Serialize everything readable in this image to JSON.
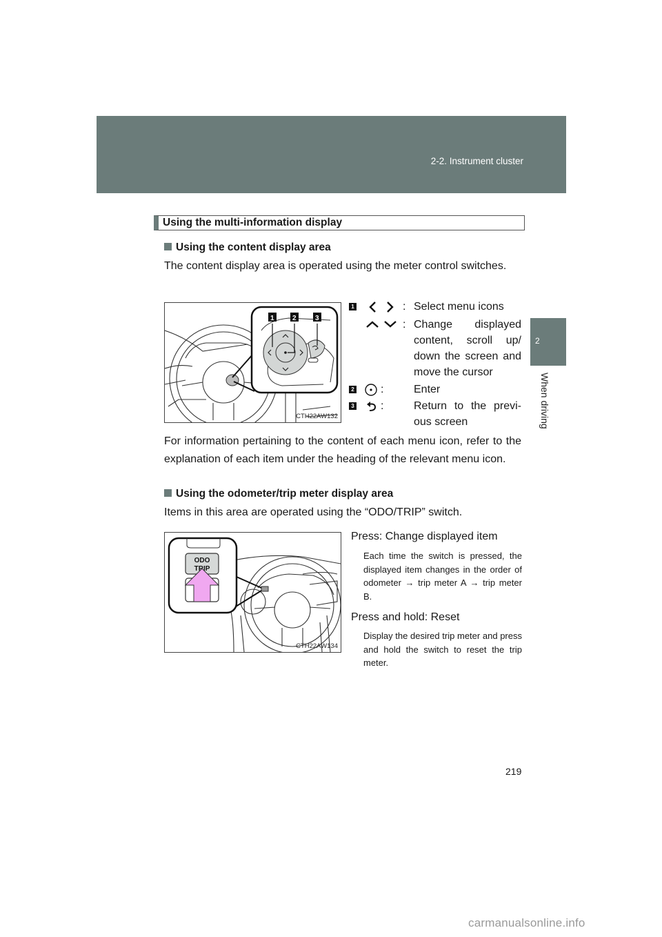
{
  "header": {
    "section": "2-2. Instrument cluster"
  },
  "chapter_tab": {
    "number": "2",
    "label": "When driving"
  },
  "section_title": "Using the multi-information display",
  "content_area": {
    "heading": "Using the content display area",
    "intro": "The content display area is operated using the meter control switches.",
    "figure_code": "CTH22AW132",
    "callouts": [
      "1",
      "2",
      "3"
    ],
    "legend": [
      {
        "badge": "1",
        "icons": [
          "chevron-left-icon",
          "chevron-right-icon"
        ],
        "text": "Select menu icons"
      },
      {
        "badge": "",
        "icons": [
          "chevron-up-icon",
          "chevron-down-icon"
        ],
        "text": "Change displayed content, scroll up/ down the screen and move the cursor"
      },
      {
        "badge": "2",
        "icons": [
          "enter-circle-icon"
        ],
        "text": "Enter"
      },
      {
        "badge": "3",
        "icons": [
          "return-arrow-icon"
        ],
        "text": "Return to the previ- ous screen"
      }
    ],
    "colon": ":",
    "note": "For information pertaining to the content of each menu icon, refer to the explanation of each item under the heading of the relevant menu icon."
  },
  "odo_area": {
    "heading": "Using the odometer/trip meter display area",
    "intro": "Items in this area are operated using the “ODO/TRIP” switch.",
    "figure_code": "CTH22AW134",
    "switch_label_line1": "ODO",
    "switch_label_line2": "TRIP",
    "press_heading": "Press: Change displayed item",
    "press_desc": "Each time the switch is pressed, the displayed item changes in the order of odometer → trip meter A → trip meter B.",
    "hold_heading": "Press and hold: Reset",
    "hold_desc": "Display the desired trip meter and press and hold the switch to reset the trip meter."
  },
  "page_number": "219",
  "watermark": "carmanualsonline.info",
  "colors": {
    "band": "#6b7c7a",
    "arrow_fill": "#f0a8f0",
    "switch_fill": "#d6d9d8"
  }
}
